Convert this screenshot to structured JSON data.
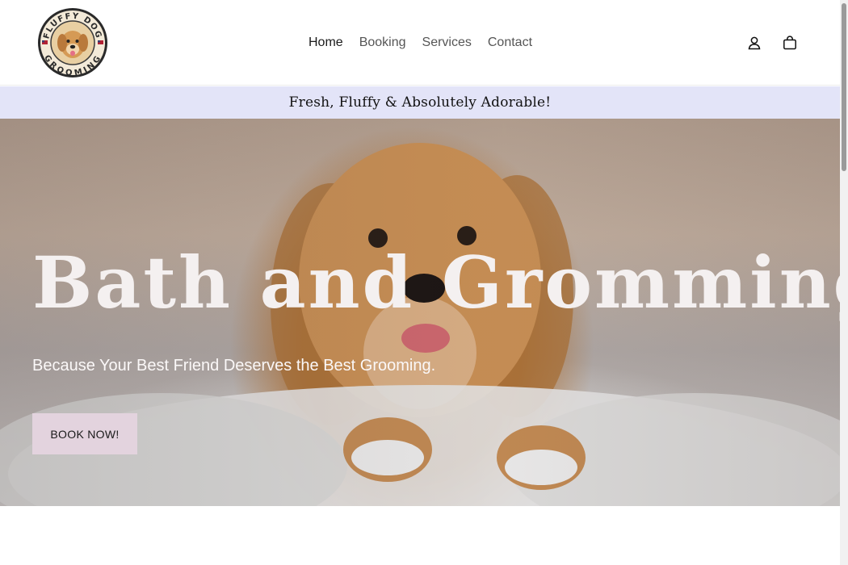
{
  "header": {
    "logo": {
      "top_text": "FLUFFY DOG",
      "bottom_text": "GROOMING",
      "icon": "golden-retriever-logo"
    },
    "nav": {
      "items": [
        {
          "label": "Home",
          "active": true
        },
        {
          "label": "Booking",
          "active": false
        },
        {
          "label": "Services",
          "active": false
        },
        {
          "label": "Contact",
          "active": false
        }
      ]
    },
    "icons": {
      "account": "user-icon",
      "cart": "shopping-bag-icon"
    }
  },
  "announcement": {
    "text": "Fresh, Fluffy & Absolutely Adorable!"
  },
  "hero": {
    "title": "Bath and Gromming",
    "subtitle": "Because Your Best Friend Deserves the Best Grooming.",
    "button_label": "BOOK NOW!",
    "image": "golden-retriever-puppy-in-bubble-bath"
  },
  "colors": {
    "announcement_bg": "#e3e4f8",
    "button_bg": "#e3d3de",
    "hero_text": "#f4f0f0"
  }
}
